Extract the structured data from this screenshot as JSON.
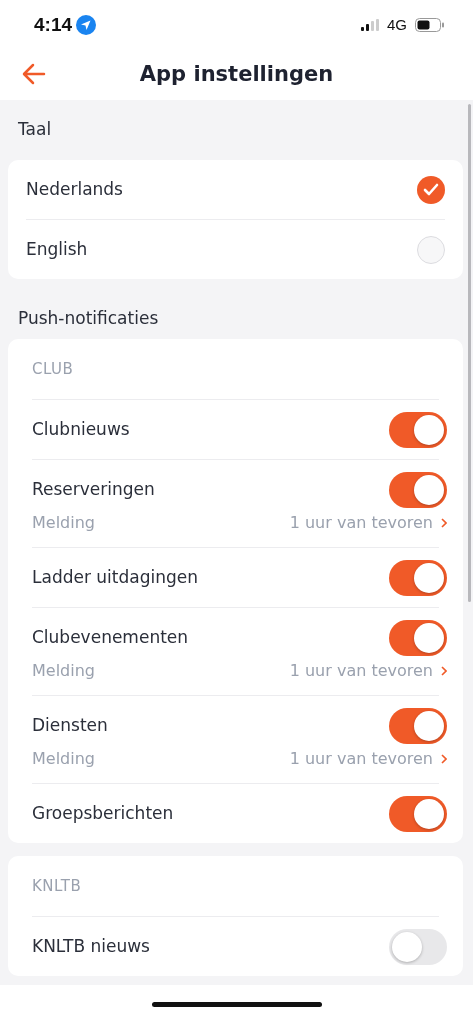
{
  "status_bar": {
    "time": "4:14",
    "network": "4G"
  },
  "header": {
    "title": "App instellingen"
  },
  "language": {
    "title": "Taal",
    "options": [
      {
        "label": "Nederlands",
        "selected": true
      },
      {
        "label": "English",
        "selected": false
      }
    ]
  },
  "push": {
    "title": "Push-notificaties",
    "groups": [
      {
        "title": "CLUB",
        "items": [
          {
            "label": "Clubnieuws",
            "on": true
          },
          {
            "label": "Reserveringen",
            "on": true,
            "notification": {
              "label": "Melding",
              "value": "1 uur van tevoren"
            }
          },
          {
            "label": "Ladder uitdagingen",
            "on": true
          },
          {
            "label": "Clubevenementen",
            "on": true,
            "notification": {
              "label": "Melding",
              "value": "1 uur van tevoren"
            }
          },
          {
            "label": "Diensten",
            "on": true,
            "notification": {
              "label": "Melding",
              "value": "1 uur van tevoren"
            }
          },
          {
            "label": "Groepsberichten",
            "on": true
          }
        ]
      },
      {
        "title": "KNLTB",
        "items": [
          {
            "label": "KNLTB nieuws",
            "on": false
          }
        ]
      }
    ]
  }
}
